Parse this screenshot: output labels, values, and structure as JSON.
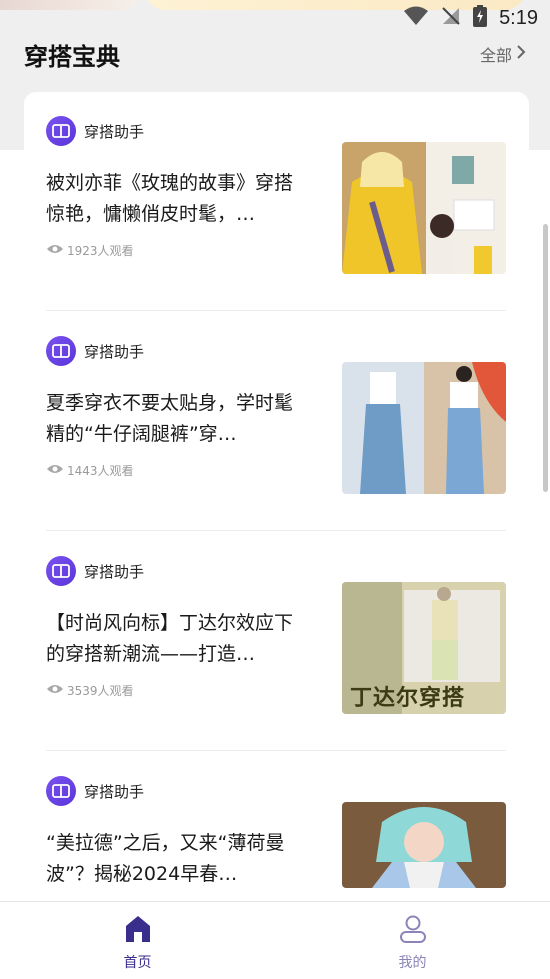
{
  "status_bar": {
    "time": "5:19"
  },
  "header": {
    "title": "穿搭宝典",
    "see_all": "全部"
  },
  "articles": [
    {
      "author": "穿搭助手",
      "title": "被刘亦菲《玫瑰的故事》穿搭惊艳，慵懒俏皮时髦，…",
      "views": "1923人观看",
      "thumb_text": ""
    },
    {
      "author": "穿搭助手",
      "title": "夏季穿衣不要太贴身，学时髦精的“牛仔阔腿裤”穿…",
      "views": "1443人观看",
      "thumb_text": ""
    },
    {
      "author": "穿搭助手",
      "title": "【时尚风向标】丁达尔效应下的穿搭新潮流——打造…",
      "views": "3539人观看",
      "thumb_text": "丁达尔穿搭"
    },
    {
      "author": "穿搭助手",
      "title": "“美拉德”之后，又来“薄荷曼波”？揭秘2024早春…",
      "views": "",
      "thumb_text": ""
    }
  ],
  "tabs": [
    {
      "label": "首页",
      "active": true,
      "icon": "home-icon"
    },
    {
      "label": "我的",
      "active": false,
      "icon": "user-icon"
    }
  ],
  "colors": {
    "accent": "#3a2e8c",
    "avatar": "#6a45e6"
  }
}
